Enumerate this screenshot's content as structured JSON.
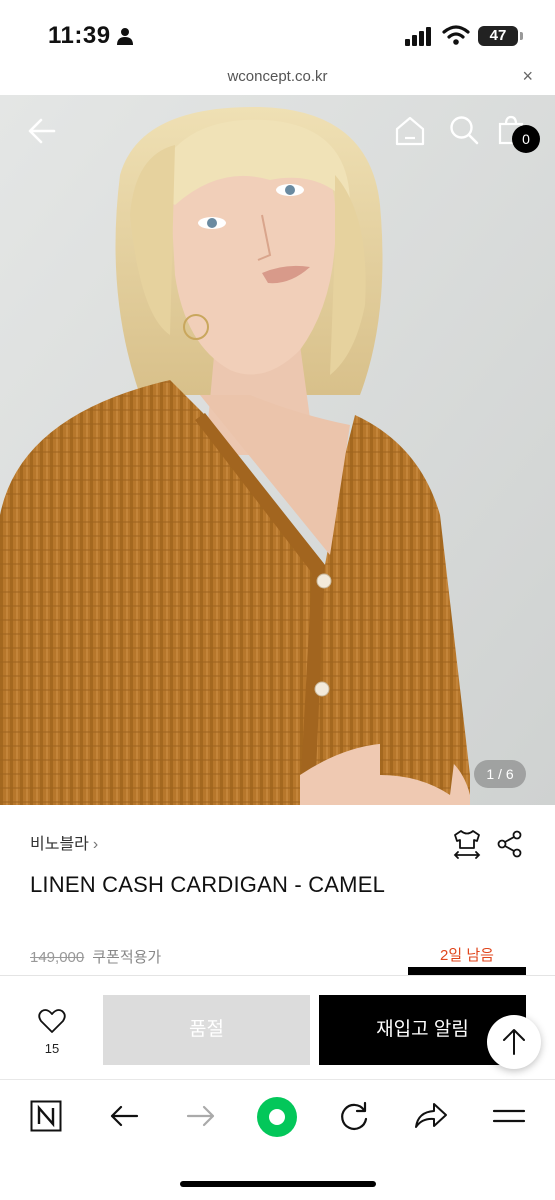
{
  "status_bar": {
    "time": "11:39",
    "battery": "47"
  },
  "browser": {
    "url": "wconcept.co.kr",
    "close_icon": "×"
  },
  "header": {
    "cart_count": "0"
  },
  "gallery": {
    "pager": "1 / 6"
  },
  "product": {
    "brand": "비노블라",
    "brand_chevron": "›",
    "title": "LINEN CASH CARDIGAN - CAMEL",
    "original_price": "149,000",
    "coupon_label": "쿠폰적용가",
    "days_left": "2일 남음"
  },
  "purchase_bar": {
    "wish_count": "15",
    "soldout_label": "품절",
    "restock_label": "재입고 알림"
  },
  "colors": {
    "accent_red": "#e0461d",
    "button_black": "#000000",
    "button_disabled": "#dcdcdc",
    "browser_green": "#03c75a",
    "sweater": "#b7772b"
  }
}
